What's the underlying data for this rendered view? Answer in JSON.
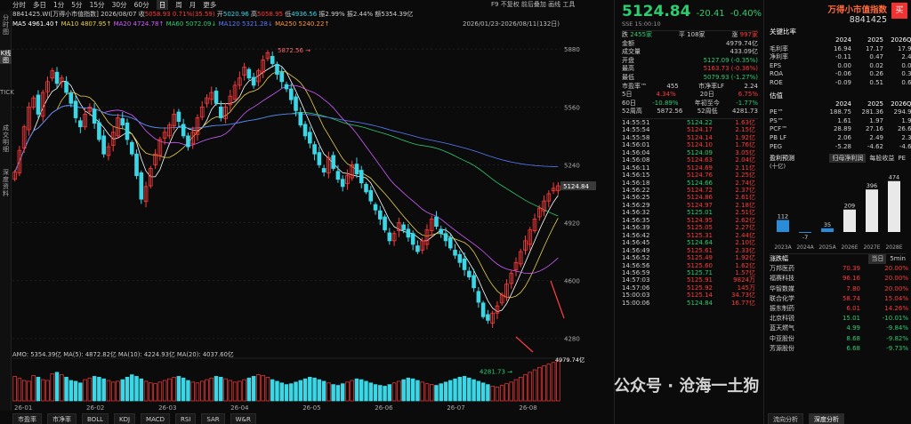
{
  "toolbar": {
    "periods": [
      "分时",
      "多日",
      "1分",
      "5分",
      "15分",
      "30分",
      "60分",
      "日",
      "周",
      "月",
      "更多"
    ],
    "active": "日",
    "hint": "F9  不复权  前后叠加  画线  工具"
  },
  "info": {
    "code": "8841425.WI[万得小市值指数]",
    "date": "2026/08/07",
    "open_l": "收",
    "open_v": "5058.93",
    "chg": "0.71%(35.59)",
    "high_l": "开",
    "high_v": "5020.96",
    "max_l": "高",
    "max_v": "5058.95",
    "min_l": "低",
    "min_v": "4936.56",
    "amp_l": "振",
    "amp": "2.99%",
    "turn_l": "振",
    "turn": "2.44%",
    "amt_l": "额",
    "amt": "5354.39亿"
  },
  "ma": {
    "ma5": "MA5 4961.40↑",
    "ma10": "MA10 4807.95↑",
    "ma20": "MA20 4724.78↑",
    "ma60": "MA60 5072.09↓",
    "ma120": "MA120 5321.28↓",
    "ma250": "MA250 5240.22↑"
  },
  "range": "2026/01/23-2026/08/11(132日)",
  "chart_data": {
    "type": "candlestick",
    "y_ticks": [
      "5880",
      "5560",
      "5240",
      "4920",
      "4600",
      "4280"
    ],
    "y_range": [
      4200,
      5950
    ],
    "x_ticks": [
      "26-01",
      "26-02",
      "26-03",
      "26-04",
      "26-05",
      "26-06",
      "26-07",
      "26-08"
    ],
    "high_label": "5872.56",
    "low_label": "4281.73",
    "last_label": "5124.84",
    "series": [
      {
        "name": "close",
        "values": [
          5200,
          5320,
          5450,
          5560,
          5610,
          5520,
          5640,
          5700,
          5760,
          5690,
          5720,
          5640,
          5580,
          5500,
          5450,
          5520,
          5560,
          5470,
          5380,
          5300,
          5340,
          5420,
          5500,
          5460,
          5380,
          5300,
          5180,
          5050,
          5120,
          5220,
          5300,
          5380,
          5420,
          5460,
          5520,
          5480,
          5400,
          5340,
          5420,
          5500,
          5560,
          5610,
          5640,
          5580,
          5500,
          5560,
          5620,
          5680,
          5720,
          5780,
          5720,
          5680,
          5760,
          5820,
          5860,
          5800,
          5740,
          5700,
          5660,
          5600,
          5540,
          5460,
          5400,
          5360,
          5300,
          5240,
          5200,
          5280,
          5220,
          5160,
          5120,
          5180,
          5240,
          5190,
          5140,
          5090,
          5040,
          4990,
          4940,
          4880,
          4820,
          4860,
          4920,
          4880,
          4840,
          4800,
          4760,
          4820,
          4880,
          4940,
          4900,
          4860,
          4820,
          4780,
          4740,
          4700,
          4660,
          4620,
          4560,
          4480,
          4400,
          4380,
          4420,
          4460,
          4520,
          4580,
          4640,
          4700,
          4760,
          4820,
          4880,
          4940,
          5000,
          5040,
          5080,
          5110,
          5124
        ]
      },
      {
        "name": "volume",
        "values": [
          60,
          55,
          50,
          48,
          62,
          58,
          52,
          50,
          66,
          70,
          64,
          58,
          50,
          48,
          44,
          52,
          56,
          60,
          58,
          54,
          50,
          46,
          48,
          52,
          58,
          64,
          60,
          54,
          48,
          44,
          42,
          46,
          50,
          54,
          58,
          60,
          56,
          50,
          46,
          44,
          48,
          52,
          56,
          60,
          58,
          54,
          50,
          46,
          48,
          52,
          56,
          60,
          64,
          62,
          58,
          52,
          48,
          44,
          40,
          42,
          46,
          50,
          54,
          58,
          56,
          52,
          48,
          44,
          40,
          38,
          42,
          46,
          50,
          54,
          52,
          48,
          44,
          40,
          38,
          36,
          40,
          44,
          48,
          52,
          56,
          54,
          50,
          46,
          42,
          40,
          38,
          42,
          46,
          50,
          54,
          58,
          60,
          56,
          52,
          48,
          44,
          40,
          36,
          34,
          38,
          42,
          46,
          52,
          58,
          64,
          70,
          76,
          82,
          86,
          90,
          94,
          98
        ]
      }
    ],
    "volume_label": "AMO: 5354.39亿  MA(5): 4872.82亿  MA(10): 4224.93亿  MA(20): 4037.60亿",
    "vol_tag": "4979.74亿"
  },
  "bottom_tabs": [
    "市盈率",
    "市净率",
    "BOLL",
    "KDJ",
    "MACD",
    "RSI",
    "SAR",
    "W&R"
  ],
  "quote": {
    "price": "5124.84",
    "chg": "-20.41",
    "pct": "-0.40%",
    "name": "万得小市值指数",
    "code": "8841425",
    "sub": "SSE 15:00:10",
    "buy": "买",
    "rise_l": "跌",
    "rise": "2455家",
    "flat_l": "平",
    "flat": "108家",
    "fall_l": "涨",
    "fall": "997家",
    "rows": [
      [
        "金额",
        "4979.74亿"
      ],
      [
        "成交量",
        "433.09亿"
      ],
      [
        "开盘",
        "5127.09 (-0.35%)"
      ],
      [
        "最高",
        "5163.73 (-0.36%)"
      ],
      [
        "最低",
        "5079.93 (-1.27%)"
      ]
    ],
    "pe_l": "市盈率™",
    "pe": "455",
    "pb_l": "市净率LF",
    "pb": "2.24",
    "d5_l": "5日",
    "d5": "4.34%",
    "d20_l": "20日",
    "d20": "6.75%",
    "d60_l": "60日",
    "d60": "-10.89%",
    "ytd_l": "年初至今",
    "ytd": "-1.77%",
    "w52h_l": "52周高",
    "w52h": "5872.56",
    "w52l_l": "52周低",
    "w52l": "4281.73"
  },
  "ticks": [
    [
      "14:55:51",
      "5124.22",
      "1.63亿"
    ],
    [
      "14:55:54",
      "5124.17",
      "2.15亿"
    ],
    [
      "14:55:58",
      "5124.14",
      "1.92亿"
    ],
    [
      "14:56:01",
      "5124.10",
      "1.76亿"
    ],
    [
      "14:56:04",
      "5124.09",
      "3.05亿"
    ],
    [
      "14:56:08",
      "5124.63",
      "2.04亿"
    ],
    [
      "14:56:11",
      "5124.69",
      "2.11亿"
    ],
    [
      "14:56:15",
      "5124.76",
      "2.25亿"
    ],
    [
      "14:56:18",
      "5124.66",
      "2.74亿"
    ],
    [
      "14:56:22",
      "5124.72",
      "2.37亿"
    ],
    [
      "14:56:25",
      "5124.86",
      "2.61亿"
    ],
    [
      "14:56:29",
      "5124.97",
      "2.18亿"
    ],
    [
      "14:56:32",
      "5125.01",
      "2.51亿"
    ],
    [
      "14:56:35",
      "5124.95",
      "2.62亿"
    ],
    [
      "14:56:39",
      "5125.05",
      "2.27亿"
    ],
    [
      "14:56:42",
      "5125.31",
      "2.44亿"
    ],
    [
      "14:56:45",
      "5124.64",
      "2.10亿"
    ],
    [
      "14:56:49",
      "5125.61",
      "2.33亿"
    ],
    [
      "14:56:52",
      "5125.49",
      "1.92亿"
    ],
    [
      "14:56:56",
      "5125.60",
      "1.62亿"
    ],
    [
      "14:56:59",
      "5125.71",
      "1.57亿"
    ],
    [
      "14:57:03",
      "5125.91",
      "9824万"
    ],
    [
      "14:57:06",
      "5125.92",
      "145万"
    ],
    [
      "15:00:03",
      "5125.14",
      "34.73亿"
    ],
    [
      "15:00:06",
      "5124.84",
      "16.77亿"
    ]
  ],
  "fin": {
    "title": "关键比率",
    "years": [
      "2024",
      "2025",
      "2026Q1"
    ],
    "rows": [
      [
        "毛利率",
        "16.94",
        "17.17",
        "17.94"
      ],
      [
        "净利率",
        "-0.11",
        "0.47",
        "2.48"
      ],
      [
        "EPS",
        "0.00",
        "0.02",
        "0.03"
      ],
      [
        "ROA",
        "-0.06",
        "0.26",
        "0.32"
      ],
      [
        "ROE",
        "-0.09",
        "0.51",
        "0.66"
      ]
    ],
    "val_title": "估值",
    "val_years": [
      "2024",
      "2025",
      "2026Q1"
    ],
    "val_rows": [
      [
        "PE™",
        "188.75",
        "281.36",
        "294.99"
      ],
      [
        "PS™",
        "1.61",
        "1.97",
        "1.95"
      ],
      [
        "PCF™",
        "28.89",
        "27.16",
        "26.68"
      ],
      [
        "PB LF",
        "2.06",
        "2.49",
        "2.38"
      ],
      [
        "PEG",
        "-5.28",
        "-4.62",
        "-4.61"
      ]
    ]
  },
  "forecast": {
    "title": "盈利预测",
    "unit": "(十亿)",
    "tabs": [
      "归母净利润",
      "每股收益",
      "PE"
    ],
    "labels": [
      "2023A",
      "2024A",
      "2025A",
      "2026E",
      "2027E",
      "2028E"
    ],
    "values": [
      112,
      -7,
      35,
      209,
      396,
      474
    ]
  },
  "sectors": {
    "title": "涨跌幅",
    "tabs": [
      "当日",
      "5min"
    ],
    "rows": [
      [
        "万邦医药",
        "70.39",
        "20.00%"
      ],
      [
        "福赛科技",
        "96.16",
        "20.00%"
      ],
      [
        "华智数媒",
        "7.80",
        "20.00%"
      ],
      [
        "联合化学",
        "58.74",
        "15.04%"
      ],
      [
        "振东制药",
        "6.01",
        "14.26%"
      ],
      [
        "北京科锐",
        "15.01",
        "-10.01%"
      ],
      [
        "蓝天燃气",
        "4.99",
        "-9.84%"
      ],
      [
        "中亚股份",
        "8.68",
        "-9.82%"
      ],
      [
        "芳源股份",
        "6.68",
        "-9.73%"
      ]
    ]
  },
  "right_bottom": [
    "流向分析",
    "深度分析"
  ],
  "watermark": "公众号 · 沧海一土狗",
  "side_tabs": [
    "分时图",
    "K线图",
    "TICK",
    "成交明细",
    "深度资料"
  ],
  "colors": {
    "up": "#ff3b3b",
    "down": "#3cd7e6",
    "bg": "#0b0b0b"
  }
}
